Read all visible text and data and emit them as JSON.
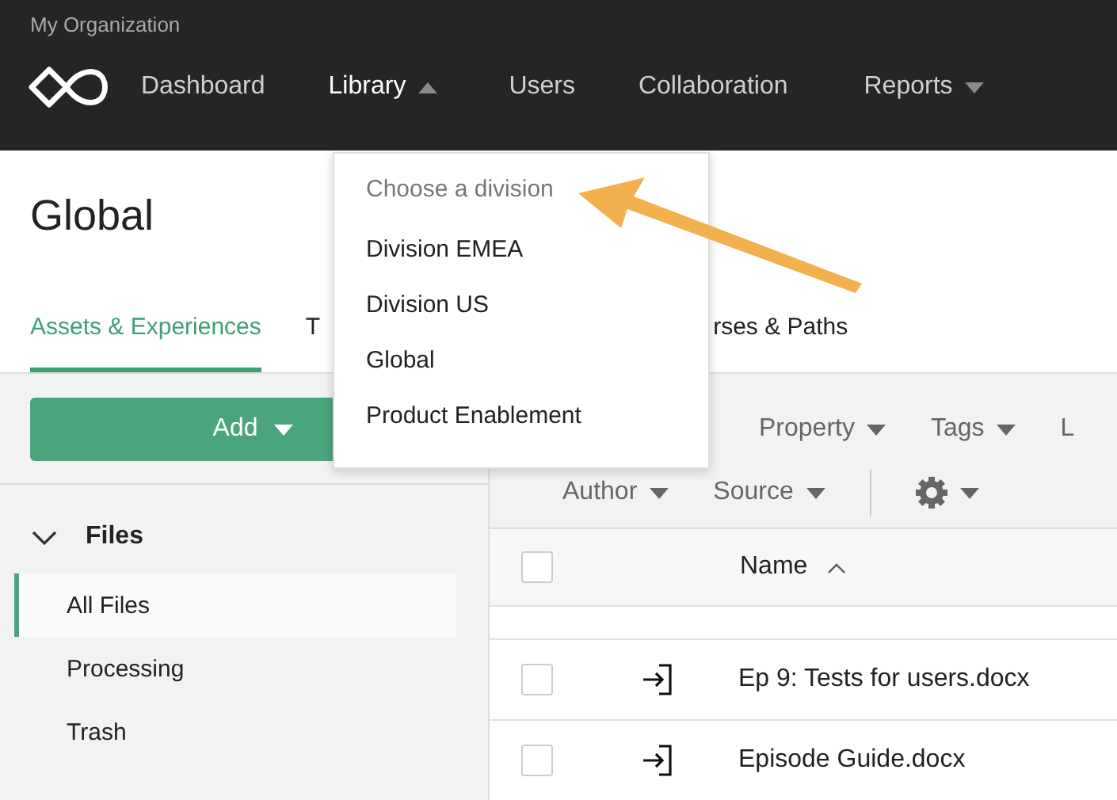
{
  "organization": "My Organization",
  "nav": [
    {
      "label": "Dashboard",
      "selected": false,
      "has_menu": false
    },
    {
      "label": "Library",
      "selected": true,
      "has_menu": true,
      "menu_open": true
    },
    {
      "label": "Users",
      "selected": false,
      "has_menu": false
    },
    {
      "label": "Collaboration",
      "selected": false,
      "has_menu": false
    },
    {
      "label": "Reports",
      "selected": false,
      "has_menu": true,
      "menu_open": false
    }
  ],
  "page_title": "Global",
  "tabs": [
    {
      "label": "Assets & Experiences",
      "selected": true
    },
    {
      "label": "T",
      "selected": false
    },
    {
      "label": "rses & Paths",
      "selected": false
    }
  ],
  "division_menu": {
    "header": "Choose a division",
    "items": [
      "Division EMEA",
      "Division US",
      "Global",
      "Product Enablement"
    ]
  },
  "add_button": "Add",
  "sidebar": {
    "section": {
      "label": "Files",
      "expanded": true
    },
    "items": [
      {
        "label": "All Files",
        "selected": true
      },
      {
        "label": "Processing",
        "selected": false
      },
      {
        "label": "Trash",
        "selected": false
      }
    ]
  },
  "filters": [
    [
      "Property",
      "Tags",
      "L"
    ],
    [
      "Author",
      "Source"
    ]
  ],
  "table": {
    "all_checked": false,
    "columns": [
      {
        "label": "Name",
        "sorted_ascending": true
      }
    ],
    "rows": [
      {
        "name": "Ep 9: Tests for users.docx",
        "checked": false
      },
      {
        "name": "Episode Guide.docx",
        "checked": false
      }
    ]
  }
}
